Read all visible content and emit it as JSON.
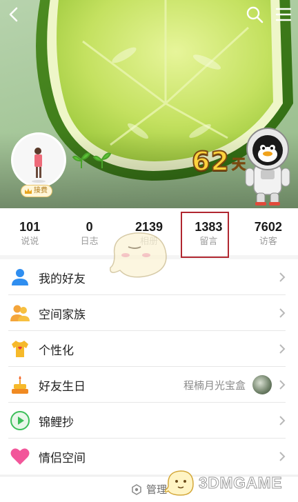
{
  "header": {
    "back_icon": "chevron-left-icon",
    "search_icon": "search-icon",
    "menu_icon": "hamburger-menu-icon",
    "days_number": "62",
    "days_unit": "天",
    "avatar_badge": "接费"
  },
  "stats": [
    {
      "value": "101",
      "label": "说说"
    },
    {
      "value": "0",
      "label": "日志"
    },
    {
      "value": "2139",
      "label": "相册"
    },
    {
      "value": "1383",
      "label": "留言"
    },
    {
      "value": "7602",
      "label": "访客"
    }
  ],
  "highlight_color": "#b0262f",
  "menu": [
    {
      "label": "我的好友",
      "icon": "friends-icon"
    },
    {
      "label": "空间家族",
      "icon": "family-icon"
    },
    {
      "label": "个性化",
      "icon": "personalize-shirt-icon"
    },
    {
      "label": "好友生日",
      "icon": "birthday-cake-icon",
      "extra": "程楠月光宝盒"
    },
    {
      "label": "锦鲤抄",
      "icon": "play-circle-icon"
    },
    {
      "label": "情侣空间",
      "icon": "heart-icon"
    }
  ],
  "bottom": {
    "manage_label": "管理",
    "manage_icon": "hexagon-settings-icon"
  },
  "watermark": {
    "text": "3DMGAME"
  }
}
